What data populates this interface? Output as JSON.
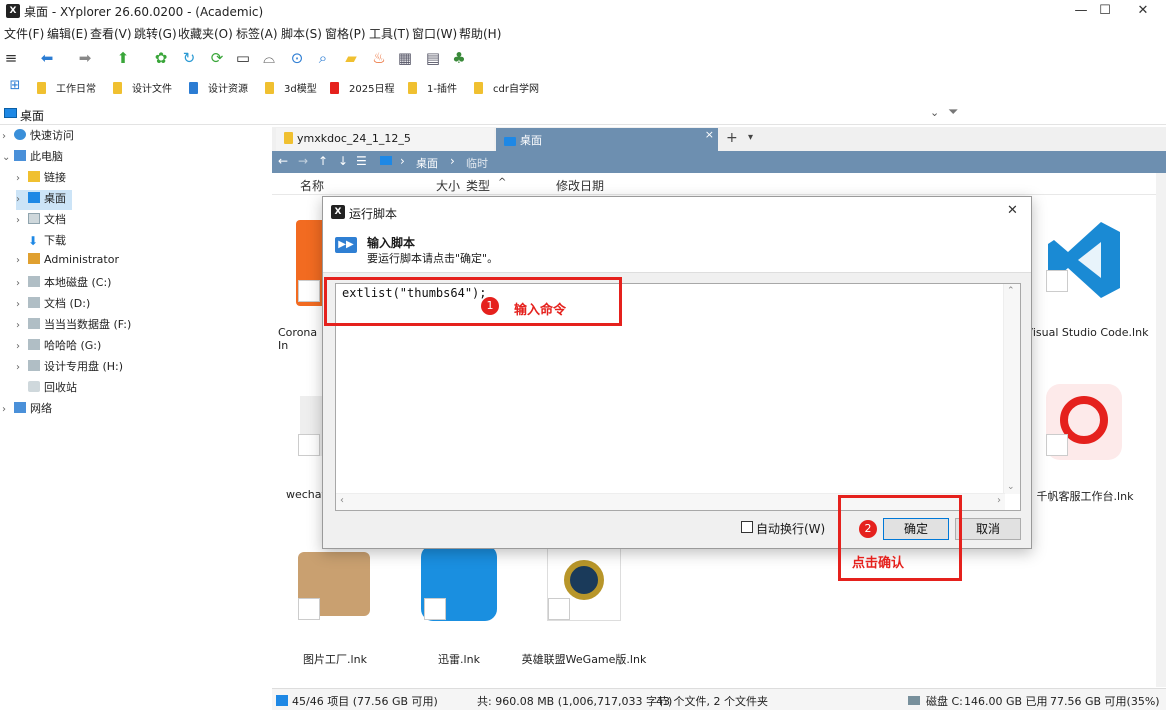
{
  "window": {
    "title": "桌面 - XYplorer 26.60.0200 - (Academic)",
    "app_icon_text": "X",
    "minimize": "—",
    "maximize": "☐",
    "close": "✕"
  },
  "menu": [
    "文件(F)",
    "编辑(E)",
    "查看(V)",
    "跳转(G)",
    "收藏夹(O)",
    "标签(A)",
    "脚本(S)",
    "窗格(P)",
    "工具(T)",
    "窗口(W)",
    "帮助(H)"
  ],
  "catalog": [
    "工作日常",
    "设计文件",
    "设计资源",
    "3d模型",
    "2025日程",
    "1-插件",
    "cdr自学网"
  ],
  "address": {
    "value": "桌面"
  },
  "tree": {
    "items": [
      {
        "label": "快速访问",
        "arrow": "›"
      },
      {
        "label": "此电脑",
        "arrow": "⌄"
      },
      {
        "label": "链接",
        "arrow": "›"
      },
      {
        "label": "桌面",
        "arrow": "›"
      },
      {
        "label": "文档",
        "arrow": "›"
      },
      {
        "label": "下载",
        "arrow": ""
      },
      {
        "label": "Administrator",
        "arrow": "›"
      },
      {
        "label": "本地磁盘 (C:)",
        "arrow": "›"
      },
      {
        "label": "文档 (D:)",
        "arrow": "›"
      },
      {
        "label": "当当当数据盘 (F:)",
        "arrow": "›"
      },
      {
        "label": "哈哈哈 (G:)",
        "arrow": "›"
      },
      {
        "label": "设计专用盘 (H:)",
        "arrow": "›"
      },
      {
        "label": "回收站",
        "arrow": ""
      },
      {
        "label": "网络",
        "arrow": "›"
      }
    ]
  },
  "tabs": {
    "tab1": "ymxkdoc_24_1_12_5",
    "tab2": "桌面",
    "tab2_close": "×",
    "add": "+",
    "menu": "▾"
  },
  "path": {
    "segment1": "桌面",
    "segment2": "临时"
  },
  "columns": {
    "name": "名称",
    "size": "大小",
    "type": "类型",
    "sort": "^",
    "modified": "修改日期"
  },
  "files": [
    {
      "label": "Corona In"
    },
    {
      "label": "Visual Studio Code.lnk"
    },
    {
      "label": "wechats"
    },
    {
      "label": "千帆客服工作台.lnk"
    },
    {
      "label": "图片工厂.lnk"
    },
    {
      "label": "迅雷.lnk"
    },
    {
      "label": "英雄联盟WeGame版.lnk"
    }
  ],
  "status": {
    "items": "45/46 项目 (77.56 GB 可用)",
    "total": "共: 960.08 MB (1,006,717,033 字节)",
    "counts": "43 个文件, 2 个文件夹",
    "disk": "磁盘 C:",
    "used": "146.00 GB 已用",
    "free": "77.56 GB 可用(35%)"
  },
  "dialog": {
    "title": "运行脚本",
    "close": "✕",
    "header_title": "输入脚本",
    "header_desc": "要运行脚本请点击\"确定\"。",
    "code": "extlist(\"thumbs64\");",
    "wrap_label": "自动换行(W)",
    "ok": "确定",
    "cancel": "取消"
  },
  "annotations": {
    "step1_num": "1",
    "step1_text": "输入命令",
    "step2_num": "2",
    "step2_text": "点击确认"
  },
  "colors": {
    "accent_red": "#e5211d",
    "pathbar": "#6d8fb0",
    "selection": "#cce4f7"
  }
}
